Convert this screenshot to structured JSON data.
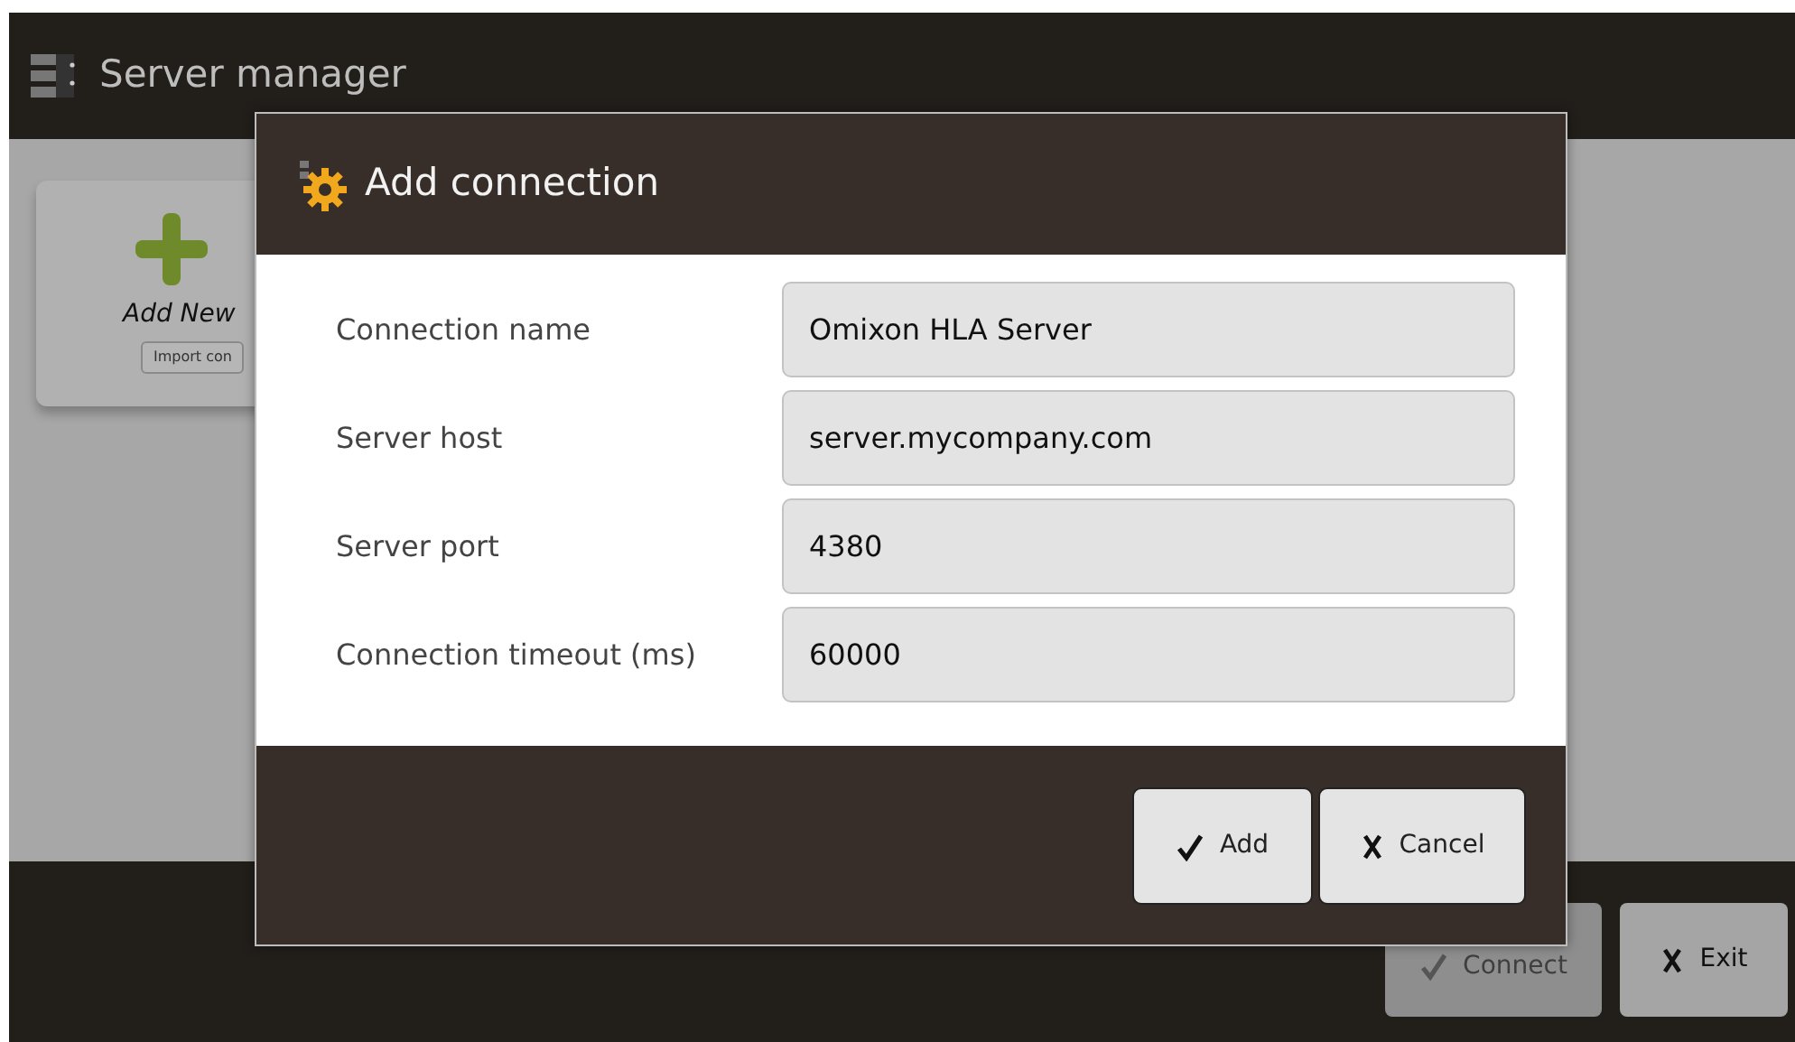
{
  "app": {
    "title": "Server manager"
  },
  "card": {
    "title": "Add New",
    "import_button": "Import con"
  },
  "footer_buttons": [
    {
      "label": "Connect",
      "kind": "confirm",
      "disabled": true
    },
    {
      "label": "Exit",
      "kind": "cancel",
      "disabled": false
    }
  ],
  "dialog": {
    "title": "Add connection",
    "fields": [
      {
        "label": "Connection name",
        "value": "Omixon HLA Server"
      },
      {
        "label": "Server host",
        "value": "server.mycompany.com"
      },
      {
        "label": "Server port",
        "value": "4380"
      },
      {
        "label": "Connection timeout (ms)",
        "value": "60000"
      }
    ],
    "buttons": [
      {
        "label": "Add",
        "kind": "confirm"
      },
      {
        "label": "Cancel",
        "kind": "cancel"
      }
    ]
  }
}
